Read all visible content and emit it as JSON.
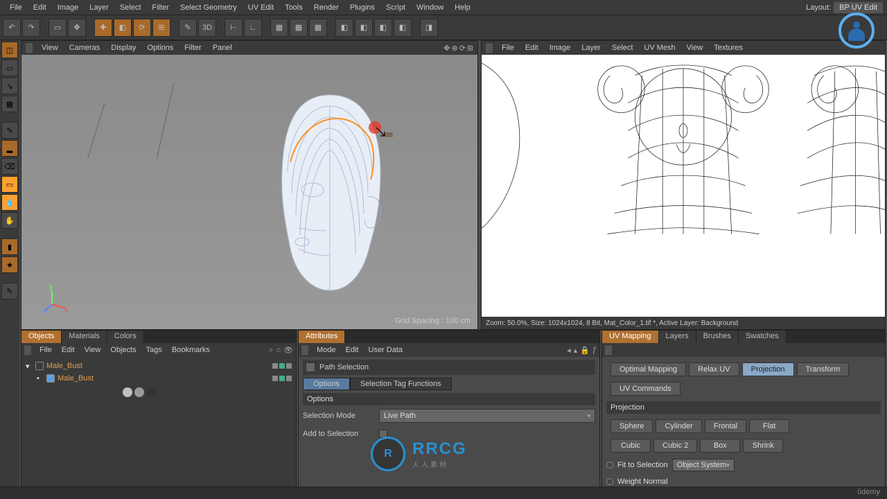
{
  "menubar": {
    "items": [
      "File",
      "Edit",
      "Image",
      "Layer",
      "Select",
      "Filter",
      "Select Geometry",
      "UV Edit",
      "Tools",
      "Render",
      "Plugins",
      "Script",
      "Window",
      "Help"
    ],
    "layout_label": "Layout:",
    "layout_value": "BP UV Edit"
  },
  "viewport3d": {
    "menus": [
      "View",
      "Cameras",
      "Display",
      "Options",
      "Filter",
      "Panel"
    ],
    "grid_spacing": "Grid Spacing : 100 cm",
    "axes": {
      "x": "x",
      "y": "y",
      "z": "z"
    }
  },
  "viewport_uv": {
    "menus": [
      "File",
      "Edit",
      "Image",
      "Layer",
      "Select",
      "UV Mesh",
      "View",
      "Textures"
    ],
    "status": "Zoom: 50.0%, Size: 1024x1024, 8 Bit, Mat_Color_1.tif *, Active Layer: Background"
  },
  "objects_panel": {
    "tabs": [
      "Objects",
      "Materials",
      "Colors"
    ],
    "menus": [
      "File",
      "Edit",
      "View",
      "Objects",
      "Tags",
      "Bookmarks"
    ],
    "tree": {
      "root": {
        "name": "Male_Bust"
      },
      "child": {
        "name": "Male_Bust"
      }
    }
  },
  "attributes_panel": {
    "tab": "Attributes",
    "menus": [
      "Mode",
      "Edit",
      "User Data"
    ],
    "banner": "Path Selection",
    "sub_tabs": {
      "options": "Options",
      "selection_tag": "Selection Tag Functions"
    },
    "section_title": "Options",
    "selection_mode_label": "Selection Mode",
    "selection_mode_value": "Live Path",
    "add_to_selection_label": "Add to Selection"
  },
  "uv_panel": {
    "tabs": [
      "UV Mapping",
      "Layers",
      "Brushes",
      "Swatches"
    ],
    "row1": {
      "optimal": "Optimal Mapping",
      "relax": "Relax UV",
      "projection": "Projection",
      "transform": "Transform"
    },
    "row2": {
      "cmds": "UV Commands"
    },
    "section_title": "Projection",
    "proj_buttons": {
      "r1": [
        "Sphere",
        "Cylinder",
        "Frontal",
        "Flat"
      ],
      "r2": [
        "Cubic",
        "Cubic 2",
        "Box",
        "Shrink"
      ]
    },
    "fit_label": "Fit to Selection",
    "fit_dd": "Object System",
    "weight_label": "Weight Normal"
  },
  "watermark": {
    "logo_text": "R",
    "text": "RRCG",
    "sub": "人人素材"
  },
  "udemy": "ûdemy"
}
